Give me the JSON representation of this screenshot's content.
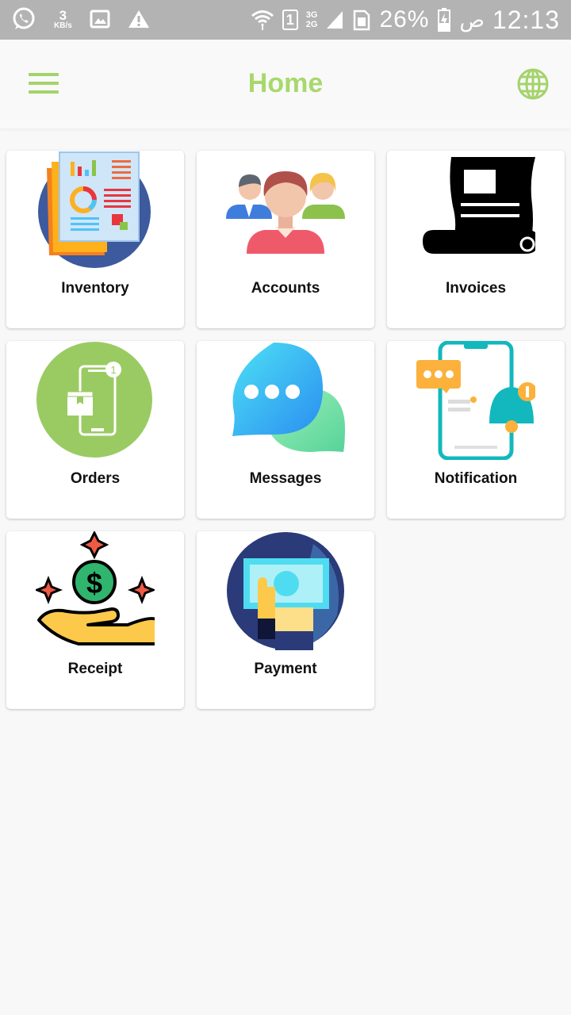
{
  "status_bar": {
    "data_speed_value": "3",
    "data_speed_unit": "KB/s",
    "network_top": "3G",
    "network_bottom": "2G",
    "sim_slot": "1",
    "battery_percent": "26%",
    "am_pm": "ص",
    "time": "12:13"
  },
  "app_bar": {
    "title": "Home",
    "accent_color": "#a8d86c"
  },
  "tiles": [
    {
      "label": "Inventory",
      "icon": "inventory-report-icon"
    },
    {
      "label": "Accounts",
      "icon": "accounts-people-icon"
    },
    {
      "label": "Invoices",
      "icon": "invoice-scroll-icon"
    },
    {
      "label": "Orders",
      "icon": "orders-phone-icon"
    },
    {
      "label": "Messages",
      "icon": "chat-bubbles-icon"
    },
    {
      "label": "Notification",
      "icon": "phone-bell-icon"
    },
    {
      "label": "Receipt",
      "icon": "hand-dollar-icon"
    },
    {
      "label": "Payment",
      "icon": "cash-payment-icon"
    }
  ]
}
